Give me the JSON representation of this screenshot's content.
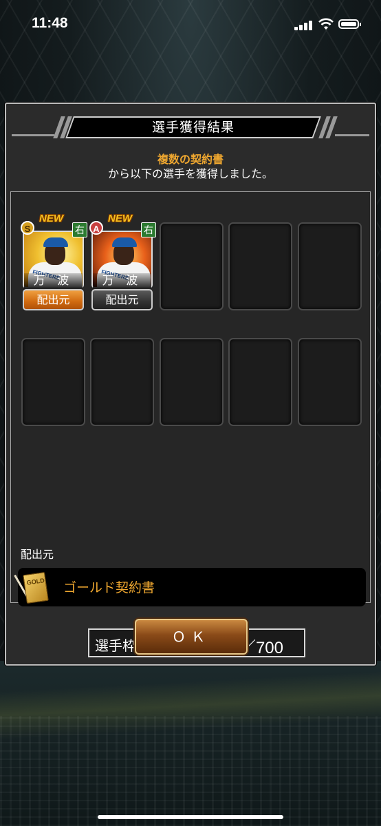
{
  "status_bar": {
    "time": "11:48"
  },
  "dialog": {
    "title": "選手獲得結果",
    "subtitle_highlight": "複数の契約書",
    "subtitle_text": "から以下の選手を獲得しました。",
    "cards": [
      {
        "rank": "S",
        "new_label": "NEW",
        "hand": "右",
        "name": "万 波",
        "button": "配出元",
        "button_style": "orange",
        "jersey_text": "FIGHTERS"
      },
      {
        "rank": "A",
        "new_label": "NEW",
        "hand": "右",
        "name": "万 波",
        "button": "配出元",
        "button_style": "gray",
        "jersey_text": "FIGHTERS"
      }
    ],
    "empty_slot_count": 8,
    "source_section": {
      "label": "配出元",
      "icon": "gold-contract-icon",
      "icon_text": "GOLD",
      "name": "ゴールド契約書"
    },
    "capacity": {
      "label": "選手枠：",
      "value": "669／700"
    },
    "ok_button": "ＯＫ"
  },
  "colors": {
    "accent_orange": "#f0a830",
    "dialog_bg": "#2b2b2b",
    "ok_button": "#8a4a18"
  }
}
